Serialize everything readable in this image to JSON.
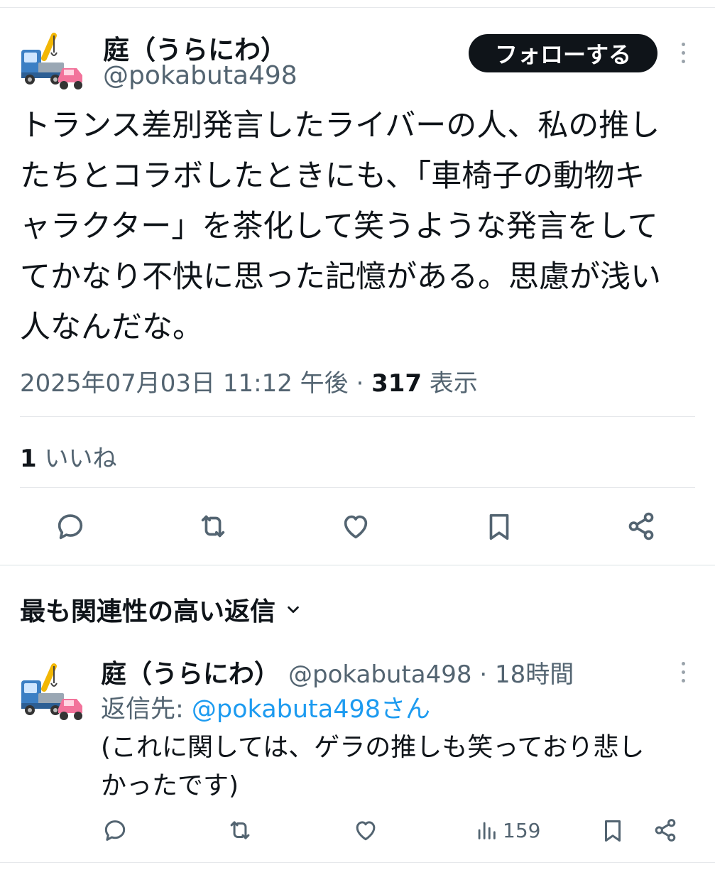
{
  "tweet": {
    "author_name": "庭（うらにわ）",
    "handle": "@pokabuta498",
    "follow_label": "フォローする",
    "text": "トランス差別発言したライバーの人、私の推し\nたちとコラボしたときにも、「車椅子の動物キ\nャラクター」を茶化して笑うような発言をして\nてかなり不快に思った記憶がある。思慮が浅い\n人なんだな。",
    "timestamp": "2025年07月03日 11:12 午後",
    "separator": " · ",
    "views_count": "317",
    "views_label": " 表示",
    "likes_count": "1",
    "likes_label": " いいね"
  },
  "actions": {
    "reply_icon": "reply-icon",
    "retweet_icon": "retweet-icon",
    "like_icon": "heart-icon",
    "bookmark_icon": "bookmark-icon",
    "share_icon": "share-icon"
  },
  "replies_section": {
    "title": "最も関連性の高い返信",
    "dropdown_icon": "chevron-down-icon"
  },
  "reply": {
    "author_name": "庭（うらにわ）",
    "handle": "@pokabuta498",
    "time": " · 18時間",
    "reply_to_prefix": "返信先: ",
    "reply_to_handle": "@pokabuta498さん",
    "text": "(これに関しては、ゲラの推しも笑っており悲し\nかったです)",
    "views": "159"
  },
  "colors": {
    "text": "#0f1419",
    "secondary": "#536471",
    "link": "#1d9bf0",
    "button_bg": "#0f1419",
    "divider": "#e6e8eb"
  }
}
